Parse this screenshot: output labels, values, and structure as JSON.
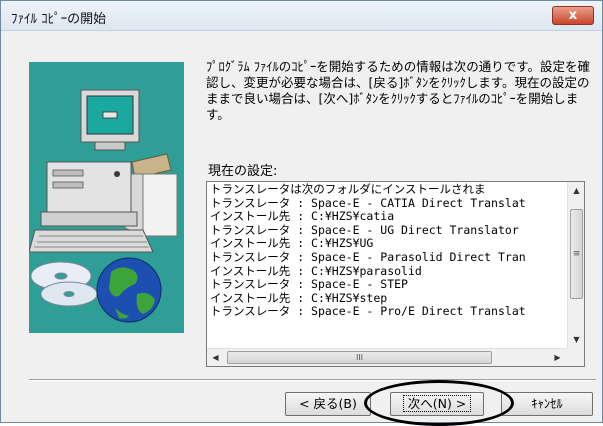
{
  "window": {
    "title": "ﾌｧｲﾙ ｺﾋﾟｰの開始",
    "close_label": "x"
  },
  "instructions": "ﾌﾟﾛｸﾞﾗﾑ ﾌｧｲﾙのｺﾋﾟｰを開始するための情報は次の通りです。設定を確認し、変更が必要な場合は、[戻る]ﾎﾞﾀﾝをｸﾘｯｸします。現在の設定のままで良い場合は、[次へ]ﾎﾞﾀﾝをｸﾘｯｸするとﾌｧｲﾙのｺﾋﾟｰを開始します。",
  "settings": {
    "label": "現在の設定:",
    "lines": [
      "トランスレータは次のフォルダにインストールされま",
      "トランスレータ : Space-E - CATIA Direct Translat",
      "インストール先 : C:¥HZS¥catia",
      "トランスレータ : Space-E - UG Direct Translator",
      "インストール先 : C:¥HZS¥UG",
      "トランスレータ : Space-E - Parasolid Direct Tran",
      "インストール先 : C:¥HZS¥parasolid",
      "トランスレータ : Space-E - STEP",
      "インストール先 : C:¥HZS¥step",
      "トランスレータ : Space-E - Pro/E Direct Translat"
    ]
  },
  "scrollbar": {
    "up_arrow": "▲",
    "down_arrow": "▼",
    "left_arrow": "◀",
    "right_arrow": "▶",
    "v_grip": "≡",
    "h_grip": "III"
  },
  "buttons": {
    "back": "< 戻る(B)",
    "next": "次へ(N) >",
    "cancel": "ｷｬﾝｾﾙ"
  },
  "colors": {
    "art_background": "#2e9e96",
    "monitor_screen": "#1aa8a0",
    "globe_ocean": "#1d4fb0",
    "globe_land": "#3ca43a"
  }
}
